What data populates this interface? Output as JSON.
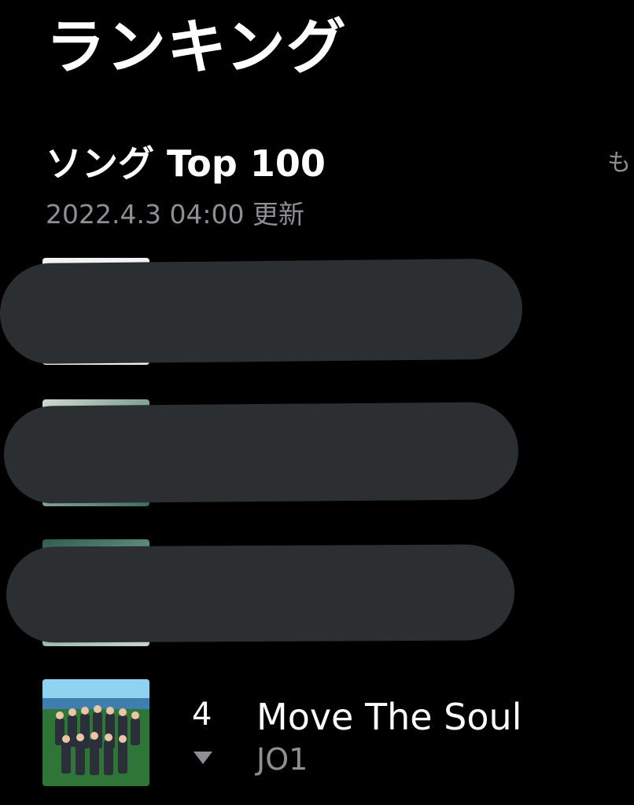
{
  "header": {
    "title": "ランキング"
  },
  "section": {
    "title": "ソング Top 100",
    "updated": "2022.4.3 04:00 更新",
    "more_label": "も"
  },
  "chart_rows": [
    {
      "rank": "4",
      "trend": "down",
      "trend_icon": "triangle-down-icon",
      "title": "Move The Soul",
      "artist": "JO1"
    }
  ]
}
